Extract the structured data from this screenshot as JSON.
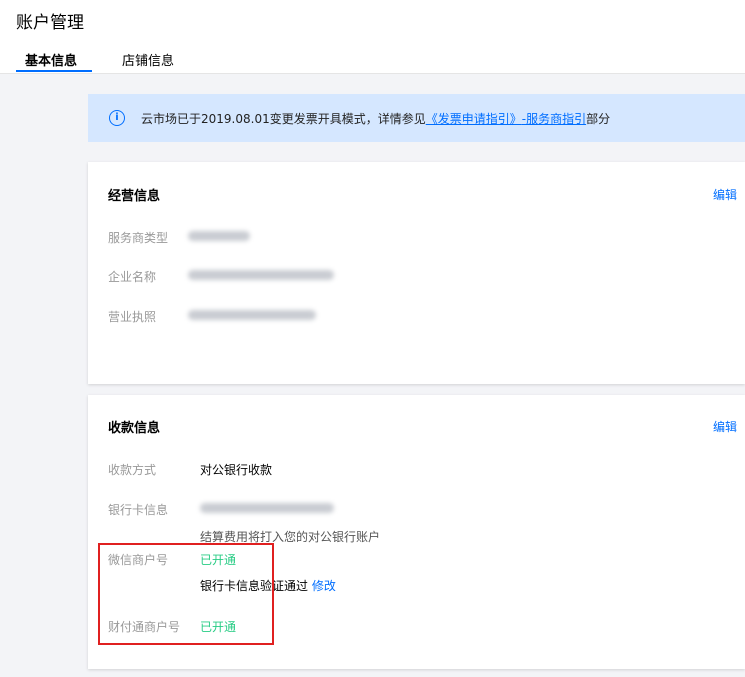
{
  "header": {
    "title": "账户管理",
    "tabs": [
      {
        "label": "基本信息",
        "active": true
      },
      {
        "label": "店铺信息",
        "active": false
      }
    ]
  },
  "notice": {
    "icon": "info-icon",
    "prefix": "云市场已于2019.08.01变更发票开具模式，详情参见",
    "link1": "《发票申请指引》",
    "link2": "-服务商指引",
    "suffix": "部分"
  },
  "business_info": {
    "title": "经营信息",
    "edit_label": "编辑",
    "rows": [
      {
        "label": "服务商类型"
      },
      {
        "label": "企业名称"
      },
      {
        "label": "营业执照"
      }
    ]
  },
  "payment_info": {
    "title": "收款信息",
    "edit_label": "编辑",
    "method_label": "收款方式",
    "method_value": "对公银行收款",
    "bank_card_label": "银行卡信息",
    "bank_card_note": "结算费用将打入您的对公银行账户",
    "wechat_label": "微信商户号",
    "wechat_status": "已开通",
    "verify_text": "银行卡信息验证通过",
    "modify_label": "修改",
    "tenpay_label": "财付通商户号",
    "tenpay_status": "已开通"
  },
  "colors": {
    "accent": "#006eff",
    "success": "#29cc85",
    "highlight": "#e02020",
    "notice_bg": "#d5e7ff"
  }
}
